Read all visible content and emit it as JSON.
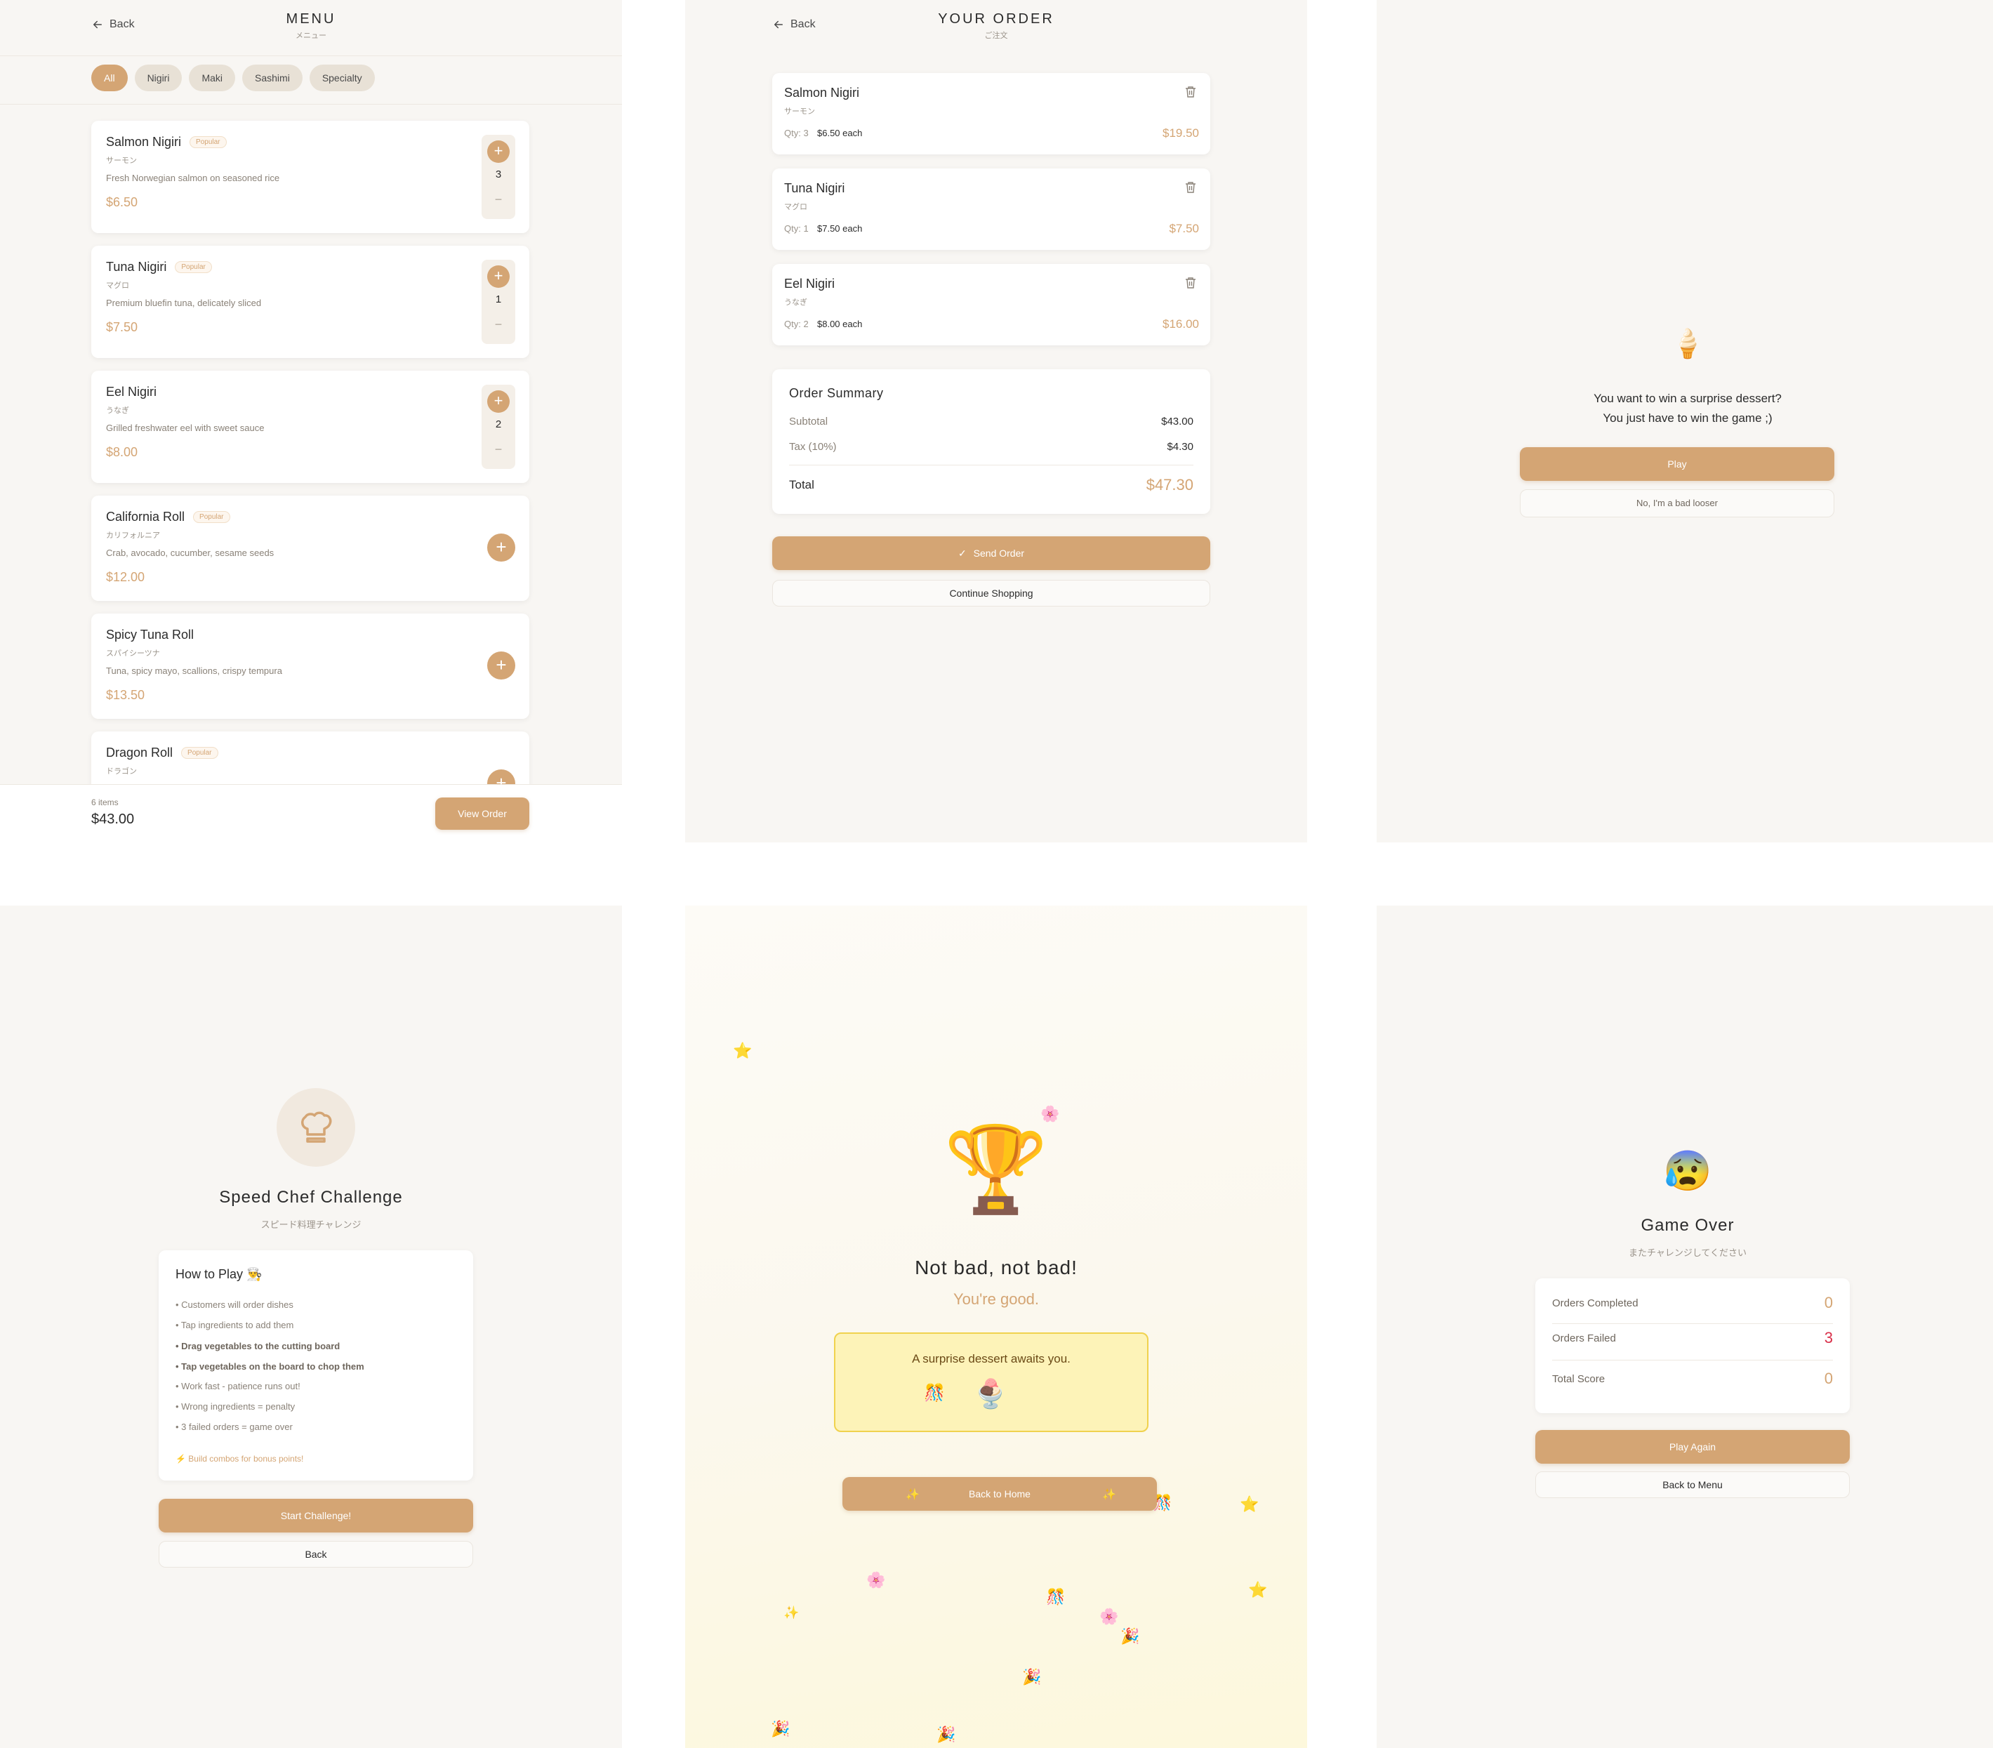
{
  "menu": {
    "back_label": "Back",
    "title": "MENU",
    "subtitle": "メニュー",
    "filters": [
      "All",
      "Nigiri",
      "Maki",
      "Sashimi",
      "Specialty"
    ],
    "active_filter": "All",
    "items": [
      {
        "name": "Salmon Nigiri",
        "badge": "Popular",
        "jp": "サーモン",
        "desc": "Fresh Norwegian salmon on seasoned rice",
        "price": "$6.50",
        "qty": "3",
        "plus": "+",
        "minus": "−"
      },
      {
        "name": "Tuna Nigiri",
        "badge": "Popular",
        "jp": "マグロ",
        "desc": "Premium bluefin tuna, delicately sliced",
        "price": "$7.50",
        "qty": "1",
        "plus": "+",
        "minus": "−"
      },
      {
        "name": "Eel Nigiri",
        "badge": "",
        "jp": "うなぎ",
        "desc": "Grilled freshwater eel with sweet sauce",
        "price": "$8.00",
        "qty": "2",
        "plus": "+",
        "minus": "−"
      },
      {
        "name": "California Roll",
        "badge": "Popular",
        "jp": "カリフォルニア",
        "desc": "Crab, avocado, cucumber, sesame seeds",
        "price": "$12.00",
        "plus": "+"
      },
      {
        "name": "Spicy Tuna Roll",
        "badge": "",
        "jp": "スパイシーツナ",
        "desc": "Tuna, spicy mayo, scallions, crispy tempura",
        "price": "$13.50",
        "plus": "+"
      },
      {
        "name": "Dragon Roll",
        "badge": "Popular",
        "jp": "ドラゴン",
        "desc": "",
        "price": "",
        "plus": "+"
      }
    ],
    "item_count": "6 items",
    "total": "$43.00",
    "view_order_label": "View Order"
  },
  "order": {
    "back_label": "Back",
    "title": "YOUR ORDER",
    "subtitle": "ご注文",
    "lines": [
      {
        "name": "Salmon Nigiri",
        "jp": "サーモン",
        "qty": "Qty: 3",
        "each": "$6.50 each",
        "total": "$19.50"
      },
      {
        "name": "Tuna Nigiri",
        "jp": "マグロ",
        "qty": "Qty: 1",
        "each": "$7.50 each",
        "total": "$7.50"
      },
      {
        "name": "Eel Nigiri",
        "jp": "うなぎ",
        "qty": "Qty: 2",
        "each": "$8.00 each",
        "total": "$16.00"
      }
    ],
    "summary": {
      "title": "Order Summary",
      "subtotal_label": "Subtotal",
      "subtotal": "$43.00",
      "tax_label": "Tax (10%)",
      "tax": "$4.30",
      "total_label": "Total",
      "total": "$47.30"
    },
    "send_label": "Send Order",
    "continue_label": "Continue Shopping"
  },
  "dessert_prompt": {
    "icon": "🍦",
    "line1": "You want to win a surprise dessert?",
    "line2": "You just have to win the game ;)",
    "play_label": "Play",
    "decline_label": "No, I'm a bad looser"
  },
  "challenge": {
    "title": "Speed Chef Challenge",
    "subtitle": "スピード料理チャレンジ",
    "howto_title": "How to Play 👨‍🍳",
    "rules": [
      {
        "text": "• Customers will order dishes",
        "bold": false
      },
      {
        "text": "• Tap ingredients to add them",
        "bold": false
      },
      {
        "text": "• Drag vegetables to the cutting board",
        "bold": true
      },
      {
        "text": "• Tap vegetables on the board to chop them",
        "bold": true
      },
      {
        "text": "• Work fast - patience runs out!",
        "bold": false
      },
      {
        "text": "• Wrong ingredients = penalty",
        "bold": false
      },
      {
        "text": "• 3 failed orders = game over",
        "bold": false
      }
    ],
    "combo_tip": "⚡ Build combos for bonus points!",
    "start_label": "Start Challenge!",
    "back_label": "Back"
  },
  "win": {
    "trophy": "🏆",
    "title": "Not bad, not bad!",
    "subtitle": "You're good.",
    "surprise_text": "A surprise dessert awaits you.",
    "surprise_icons": [
      "🎊",
      "🍨"
    ],
    "back_home_label": "Back to Home",
    "sparkle": "✨",
    "confetti": [
      "⭐",
      "🌸",
      "⭐",
      "🎊",
      "⭐",
      "🌸",
      "✨",
      "🎊",
      "🌸",
      "🎉",
      "🎉",
      "🎉",
      "🎉"
    ]
  },
  "game_over": {
    "icon": "😰",
    "title": "Game Over",
    "subtitle": "またチャレンジしてください",
    "stats": [
      {
        "label": "Orders Completed",
        "value": "0"
      },
      {
        "label": "Orders Failed",
        "value": "3"
      },
      {
        "label": "Total Score",
        "value": "0"
      }
    ],
    "play_again_label": "Play Again",
    "back_menu_label": "Back to Menu"
  },
  "colors": {
    "accent": "#d4a574",
    "background": "#f8f6f3",
    "danger": "#d9304a",
    "highlight": "#fdf3b8"
  }
}
